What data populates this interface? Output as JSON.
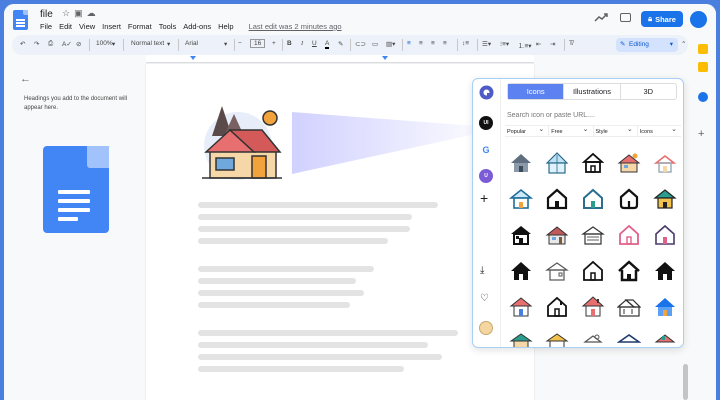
{
  "header": {
    "title": "file",
    "menu": [
      "File",
      "Edit",
      "View",
      "Insert",
      "Format",
      "Tools",
      "Add-ons",
      "Help"
    ],
    "last_edit": "Last edit was 2 minutes ago",
    "share_label": "Share"
  },
  "toolbar": {
    "zoom": "100%",
    "style": "Normal text",
    "font": "Arial",
    "font_size": "16",
    "mode": "Editing"
  },
  "outline": {
    "hint": "Headings you add to the document will appear here."
  },
  "panel": {
    "tabs": [
      {
        "label": "Icons",
        "active": true
      },
      {
        "label": "Illustrations",
        "active": false
      },
      {
        "label": "3D",
        "active": false
      }
    ],
    "search_placeholder": "Search icon or paste URL....",
    "filters": [
      "Popular",
      "Free",
      "Style",
      "Icons"
    ],
    "side_badges": [
      "UI",
      "U"
    ]
  },
  "colors": {
    "accent": "#1a73e8",
    "panel_tab_active": "#5b82f0",
    "background_frame": "#4a7fe0",
    "house_roof": "#e76f6f",
    "house_wall": "#f6d7a8",
    "house_teal": "#2a9d8f"
  }
}
